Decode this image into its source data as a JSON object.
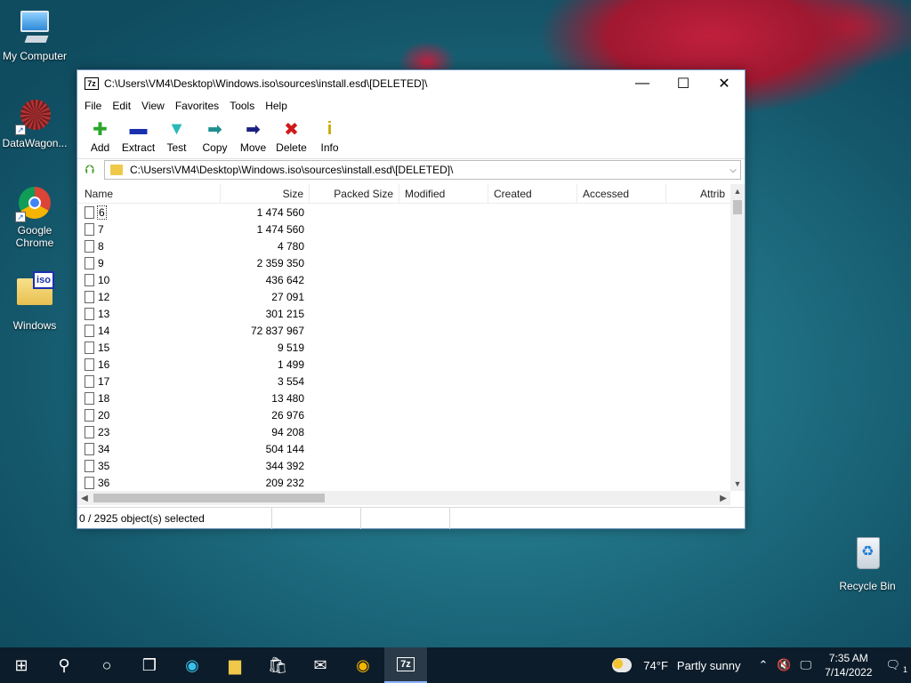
{
  "desktop": {
    "icons": [
      {
        "label": "My Computer"
      },
      {
        "label": "DataWagon..."
      },
      {
        "label": "Google Chrome"
      },
      {
        "label": "Windows",
        "badge": "iso"
      },
      {
        "label": "Recycle Bin"
      }
    ]
  },
  "window": {
    "app_icon": "7z",
    "title": "C:\\Users\\VM4\\Desktop\\Windows.iso\\sources\\install.esd\\[DELETED]\\",
    "controls": {
      "minimize": "—",
      "maximize": "☐",
      "close": "✕"
    }
  },
  "menu": [
    "File",
    "Edit",
    "View",
    "Favorites",
    "Tools",
    "Help"
  ],
  "toolbar": [
    {
      "label": "Add",
      "icon": "add-icon",
      "glyph": "✚",
      "color": "#2aa52a"
    },
    {
      "label": "Extract",
      "icon": "extract-icon",
      "glyph": "▬",
      "color": "#1a2fb0"
    },
    {
      "label": "Test",
      "icon": "test-icon",
      "glyph": "▼",
      "color": "#2ab8b8"
    },
    {
      "label": "Copy",
      "icon": "copy-icon",
      "glyph": "➡",
      "color": "#1f8f8f"
    },
    {
      "label": "Move",
      "icon": "move-icon",
      "glyph": "➡",
      "color": "#1a2080"
    },
    {
      "label": "Delete",
      "icon": "delete-icon",
      "glyph": "✖",
      "color": "#d01818"
    },
    {
      "label": "Info",
      "icon": "info-icon",
      "glyph": "i",
      "color": "#c8a800"
    }
  ],
  "address": {
    "path": "C:\\Users\\VM4\\Desktop\\Windows.iso\\sources\\install.esd\\[DELETED]\\"
  },
  "columns": {
    "name": "Name",
    "size": "Size",
    "packed": "Packed Size",
    "modified": "Modified",
    "created": "Created",
    "accessed": "Accessed",
    "attrib": "Attrib"
  },
  "files": [
    {
      "name": "6",
      "size": "1 474 560"
    },
    {
      "name": "7",
      "size": "1 474 560"
    },
    {
      "name": "8",
      "size": "4 780"
    },
    {
      "name": "9",
      "size": "2 359 350"
    },
    {
      "name": "10",
      "size": "436 642"
    },
    {
      "name": "12",
      "size": "27 091"
    },
    {
      "name": "13",
      "size": "301 215"
    },
    {
      "name": "14",
      "size": "72 837 967"
    },
    {
      "name": "15",
      "size": "9 519"
    },
    {
      "name": "16",
      "size": "1 499"
    },
    {
      "name": "17",
      "size": "3 554"
    },
    {
      "name": "18",
      "size": "13 480"
    },
    {
      "name": "20",
      "size": "26 976"
    },
    {
      "name": "23",
      "size": "94 208"
    },
    {
      "name": "34",
      "size": "504 144"
    },
    {
      "name": "35",
      "size": "344 392"
    },
    {
      "name": "36",
      "size": "209 232"
    }
  ],
  "status": {
    "selection": "0 / 2925 object(s) selected"
  },
  "taskbar": {
    "weather_temp": "74°F",
    "weather_desc": "Partly sunny",
    "time": "7:35 AM",
    "date": "7/14/2022",
    "notification_count": "1"
  }
}
